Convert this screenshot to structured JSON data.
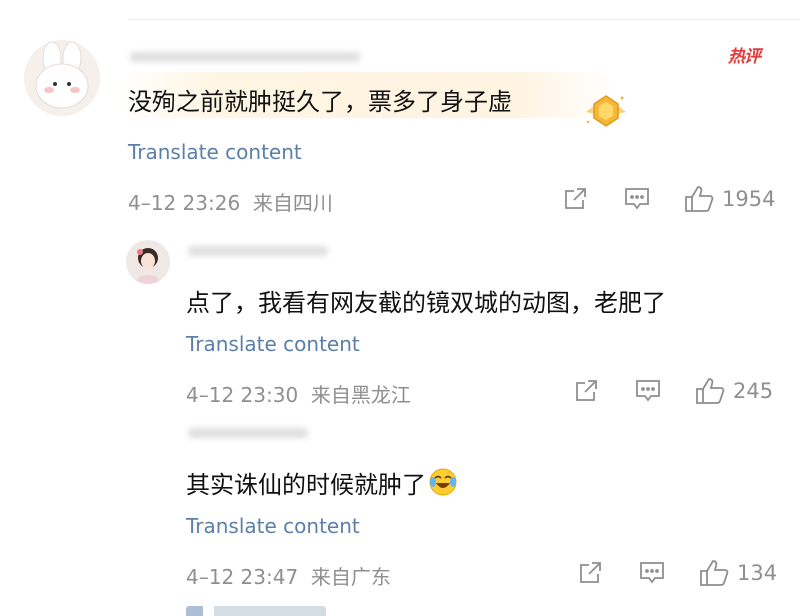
{
  "hot_badge": "热评",
  "comments": [
    {
      "text": "没殉之前就肿挺久了，票多了身子虚",
      "translate": "Translate content",
      "date": "4–12 23:26",
      "location": "来自四川",
      "likes": "1954"
    },
    {
      "text": "点了，我看有网友截的镜双城的动图，老肥了",
      "translate": "Translate content",
      "date": "4–12 23:30",
      "location": "来自黑龙江",
      "likes": "245"
    },
    {
      "text": "其实诛仙的时候就肿了",
      "translate": "Translate content",
      "date": "4–12 23:47",
      "location": "来自广东",
      "likes": "134"
    }
  ],
  "icons": [
    "share-icon",
    "comment-icon",
    "like-icon",
    "gold-medal-icon",
    "laugh-cry-emoji-icon"
  ],
  "colors": {
    "translate": "#5b7fa8",
    "meta": "#8f8f8f",
    "hot": "#e23b3b",
    "highlight": "#fff5e3"
  }
}
